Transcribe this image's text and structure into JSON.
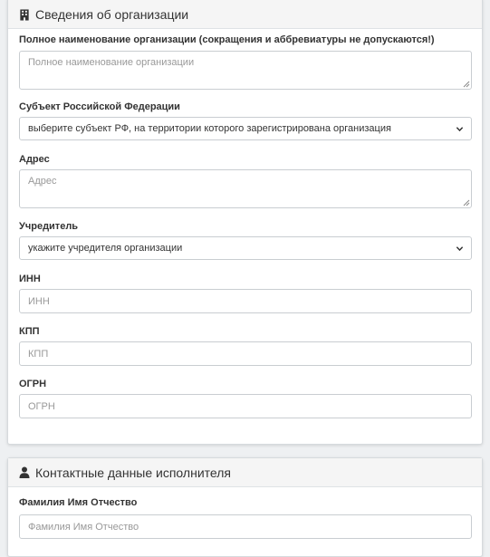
{
  "org_section": {
    "title": "Сведения об организации",
    "icon": "building-icon",
    "fields": {
      "full_name": {
        "label": "Полное наименование организации (сокращения и аббревиатуры не допускаются!)",
        "placeholder": "Полное наименование организации",
        "value": ""
      },
      "region": {
        "label": "Субъект Российской Федерации",
        "selected": "выберите субъект РФ, на территории которого зарегистрирована организация"
      },
      "address": {
        "label": "Адрес",
        "placeholder": "Адрес",
        "value": ""
      },
      "founder": {
        "label": "Учредитель",
        "selected": "укажите учредителя организации"
      },
      "inn": {
        "label": "ИНН",
        "placeholder": "ИНН",
        "value": ""
      },
      "kpp": {
        "label": "КПП",
        "placeholder": "КПП",
        "value": ""
      },
      "ogrn": {
        "label": "ОГРН",
        "placeholder": "ОГРН",
        "value": ""
      }
    }
  },
  "contact_section": {
    "title": "Контактные данные исполнителя",
    "icon": "user-icon",
    "fields": {
      "fio": {
        "label": "Фамилия Имя Отчество",
        "placeholder": "Фамилия Имя Отчество",
        "value": ""
      }
    }
  }
}
